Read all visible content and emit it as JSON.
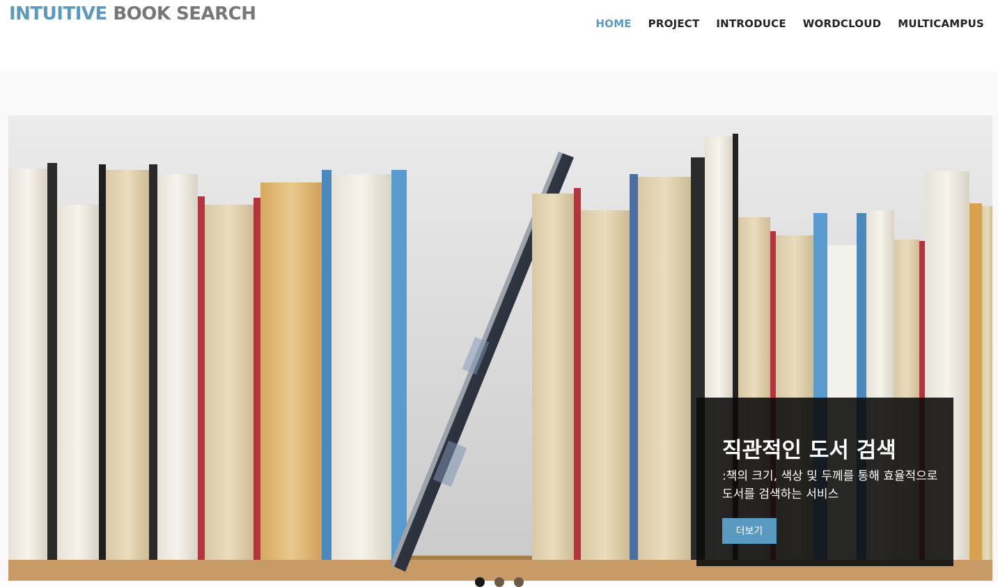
{
  "header": {
    "logo_accent": "INTUITIVE",
    "logo_rest": "BOOK SEARCH",
    "nav": [
      {
        "label": "HOME",
        "active": true
      },
      {
        "label": "PROJECT",
        "active": false
      },
      {
        "label": "INTRODUCE",
        "active": false
      },
      {
        "label": "WORDCLOUD",
        "active": false
      },
      {
        "label": "MULTICAMPUS",
        "active": false
      }
    ]
  },
  "hero": {
    "caption_title": "직관적인 도서 검색",
    "caption_text": ":책의 크기, 색상 및 두께를 통해 효율적으로 도서를 검색하는 서비스",
    "more_button": "더보기",
    "slide_count": 3,
    "active_slide": 1
  },
  "colors": {
    "accent": "#5b9ac0",
    "nav_text": "#222222",
    "logo_gray": "#777777"
  }
}
